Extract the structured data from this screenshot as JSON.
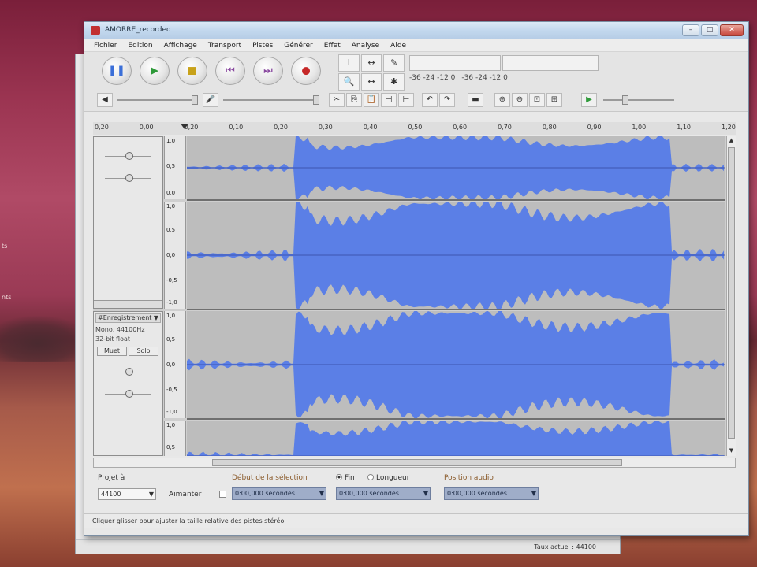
{
  "desktop": {
    "labels": [
      "ts",
      "nts"
    ]
  },
  "background_window": {
    "status_text": "Taux actuel : 44100"
  },
  "window": {
    "title": "AMORRE_recorded",
    "buttons": {
      "minimize": "–",
      "maximize": "□",
      "close": "✕"
    },
    "accent": "#5b7fe6"
  },
  "menu": [
    "Fichier",
    "Edition",
    "Affichage",
    "Transport",
    "Pistes",
    "Générer",
    "Effet",
    "Analyse",
    "Aide"
  ],
  "transport": [
    {
      "name": "pause",
      "glyph": "❚❚",
      "color": "#3b6fd8"
    },
    {
      "name": "play",
      "glyph": "▶",
      "color": "#2f9a3a"
    },
    {
      "name": "stop",
      "glyph": "■",
      "color": "#c8a21a"
    },
    {
      "name": "skip-start",
      "glyph": "⏮",
      "color": "#8a4aa0"
    },
    {
      "name": "skip-end",
      "glyph": "⏭",
      "color": "#8a4aa0"
    },
    {
      "name": "record",
      "glyph": "●",
      "color": "#c62828"
    }
  ],
  "tools": [
    "I",
    "↔",
    "✎",
    "🔍",
    "↔",
    "✱"
  ],
  "meters": {
    "left_ticks": "-36  -24  -12  0",
    "right_ticks": "-36  -24  -12  0"
  },
  "ruler": {
    "ticks": [
      "0,20",
      "0,00",
      "0,20",
      "0,10",
      "0,20",
      "0,30",
      "0,40",
      "0,50",
      "0,60",
      "0,70",
      "0,80",
      "0,90",
      "1,00",
      "1,10",
      "1,20"
    ]
  },
  "tracks": [
    {
      "name": "",
      "info_lines": [
        "",
        ""
      ],
      "mute": "",
      "solo": "",
      "channels": [
        {
          "ticks": [
            "1,0",
            "0,5",
            "0,0"
          ]
        },
        {
          "ticks": [
            "1,0",
            "0,5",
            "0,0",
            "-0,5",
            "-1,0"
          ]
        }
      ]
    },
    {
      "name": "#Enregistrement",
      "info_lines": [
        "Mono, 44100Hz",
        "32-bit float"
      ],
      "mute": "Muet",
      "solo": "Solo",
      "channels": [
        {
          "ticks": [
            "1,0",
            "0,5",
            "0,0",
            "-0,5",
            "-1,0"
          ]
        },
        {
          "ticks": [
            "1,0",
            "0,5"
          ]
        }
      ]
    }
  ],
  "selection_bar": {
    "project_rate_label": "Projet à",
    "project_rate_value": "44100",
    "snap_label": "Aimanter",
    "sel_start_label": "Début de la sélection",
    "end_label": "Fin",
    "length_label": "Longueur",
    "audio_pos_label": "Position audio",
    "sel_start_value": "0:00,000 secondes",
    "sel_end_value": "0:00,000 secondes",
    "audio_pos_value": "0:00,000 secondes"
  },
  "status": {
    "text": "Cliquer glisser pour ajuster la taille relative des pistes stéréo"
  }
}
